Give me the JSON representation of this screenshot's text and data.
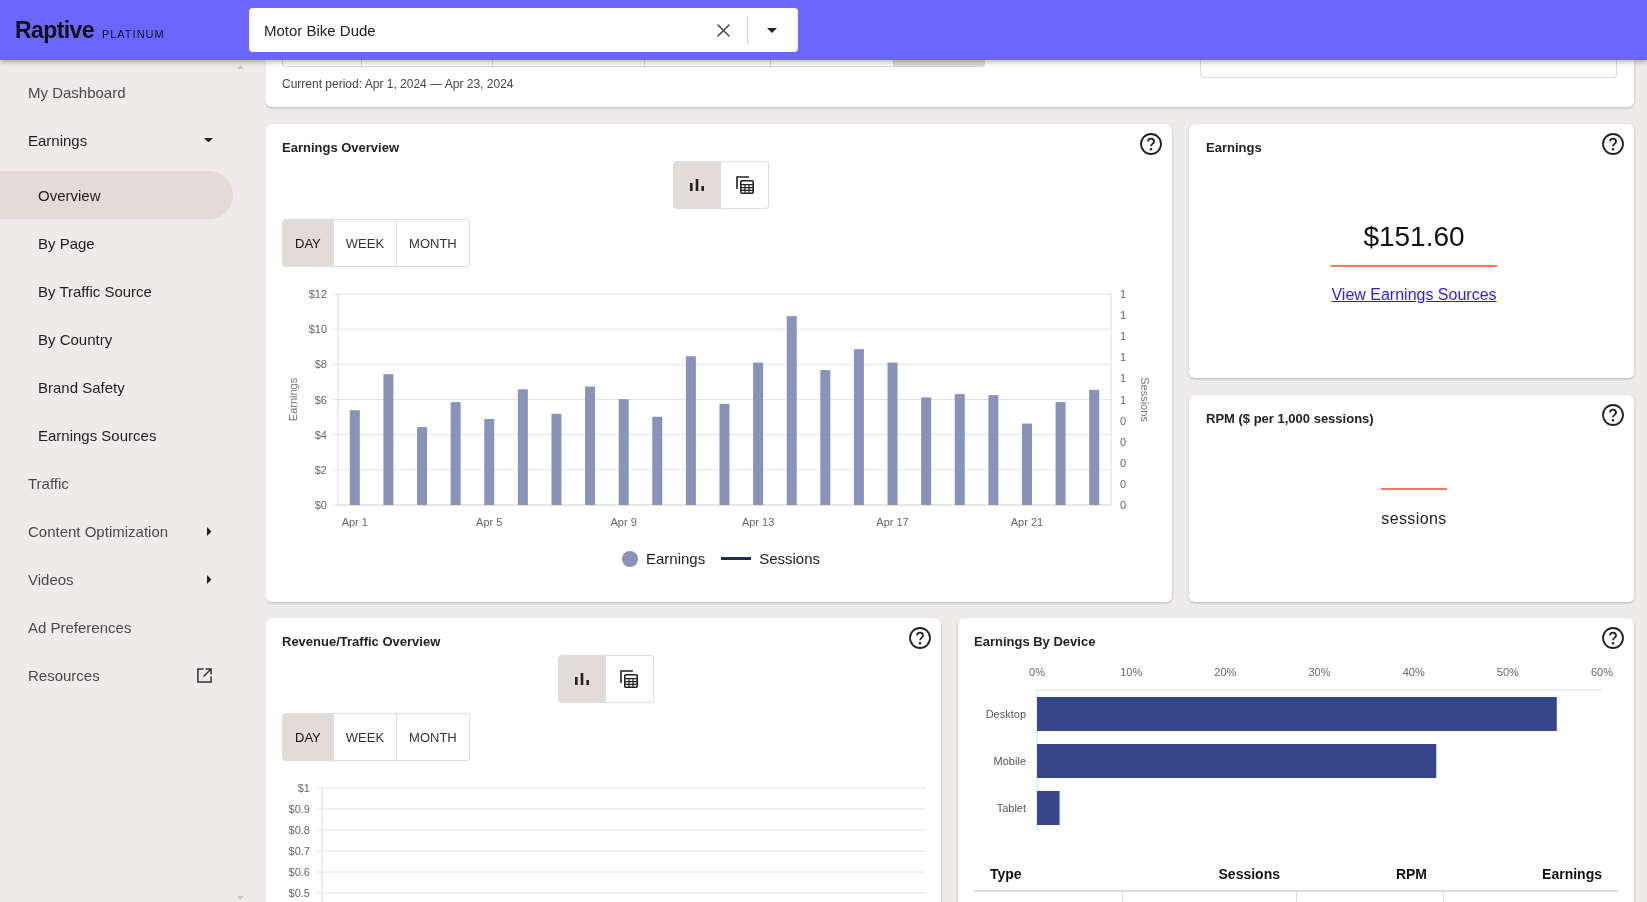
{
  "header": {
    "logo": "Raptive",
    "tier": "PLATINUM",
    "site_select": {
      "value": "Motor Bike Dude"
    }
  },
  "sidebar": {
    "items": [
      {
        "label": "My Dashboard",
        "kind": "link",
        "selected": false
      },
      {
        "label": "Earnings",
        "kind": "group",
        "expanded": true,
        "selected": false,
        "children": [
          {
            "label": "Overview",
            "selected": true
          },
          {
            "label": "By Page",
            "selected": false
          },
          {
            "label": "By Traffic Source",
            "selected": false
          },
          {
            "label": "By Country",
            "selected": false
          },
          {
            "label": "Brand Safety",
            "selected": false
          },
          {
            "label": "Earnings Sources",
            "selected": false
          }
        ]
      },
      {
        "label": "Traffic",
        "kind": "link",
        "selected": false
      },
      {
        "label": "Content Optimization",
        "kind": "group",
        "expanded": false,
        "selected": false
      },
      {
        "label": "Videos",
        "kind": "group",
        "expanded": false,
        "selected": false
      },
      {
        "label": "Ad Preferences",
        "kind": "link",
        "selected": false
      },
      {
        "label": "Resources",
        "kind": "external",
        "selected": false
      }
    ]
  },
  "period_bar": {
    "options": [
      {
        "selected": false
      },
      {
        "selected": false
      },
      {
        "selected": false
      },
      {
        "selected": false
      },
      {
        "selected": false
      },
      {
        "selected": true
      }
    ],
    "current_period": "Current period: Apr 1, 2024 — Apr 23, 2024"
  },
  "earnings_overview": {
    "title": "Earnings Overview",
    "view_toggle": [
      {
        "kind": "chart",
        "selected": true
      },
      {
        "kind": "table",
        "selected": false
      }
    ],
    "ranges": [
      {
        "label": "DAY",
        "selected": true
      },
      {
        "label": "WEEK",
        "selected": false
      },
      {
        "label": "MONTH",
        "selected": false
      }
    ],
    "chart_data": {
      "type": "bar",
      "grid": true,
      "ylabel": "Earnings",
      "categories": [
        "Apr 1",
        null,
        null,
        null,
        "Apr 5",
        null,
        null,
        null,
        "Apr 9",
        null,
        null,
        null,
        "Apr 13",
        null,
        null,
        null,
        "Apr 17",
        null,
        null,
        null,
        "Apr 21",
        null,
        null
      ],
      "ylim": [
        0,
        12
      ],
      "yticks": [
        {
          "value": 0,
          "label": "$0"
        },
        {
          "value": 2,
          "label": "$2"
        },
        {
          "value": 4,
          "label": "$4"
        },
        {
          "value": 6,
          "label": "$6"
        },
        {
          "value": 8,
          "label": "$8"
        },
        {
          "value": 10,
          "label": "$10"
        },
        {
          "value": 12,
          "label": "$12"
        }
      ],
      "series": [
        {
          "color": "#8893b9",
          "values": [
            5.39,
            7.44,
            4.43,
            5.85,
            4.89,
            6.58,
            5.19,
            6.74,
            6.02,
            5.02,
            8.46,
            5.75,
            8.1,
            10.74,
            7.67,
            8.86,
            8.1,
            6.12,
            6.31,
            6.25,
            4.63,
            5.85,
            6.55
          ]
        }
      ]
    },
    "secondary_axis": {
      "label": "Sessions",
      "ticks": [
        "1",
        "1",
        "1",
        "1",
        "1",
        "1",
        "0",
        "0",
        "0",
        "0",
        "0"
      ]
    },
    "legend": [
      {
        "label": "Earnings",
        "kind": "dot",
        "color": "#8893b9"
      },
      {
        "label": "Sessions",
        "kind": "line",
        "color": "#1f2b5b"
      }
    ]
  },
  "earnings_card": {
    "title": "Earnings",
    "value": "$151.60",
    "link": "View Earnings Sources"
  },
  "rpm_card": {
    "title": "RPM ($ per 1,000 sessions)",
    "caption": "sessions"
  },
  "revenue_traffic": {
    "title": "Revenue/Traffic Overview",
    "view_toggle": [
      {
        "kind": "chart",
        "selected": true
      },
      {
        "kind": "table",
        "selected": false
      }
    ],
    "ranges": [
      {
        "label": "DAY",
        "selected": true
      },
      {
        "label": "WEEK",
        "selected": false
      },
      {
        "label": "MONTH",
        "selected": false
      }
    ],
    "y_ticks": [
      "$1",
      "$0.9",
      "$0.8",
      "$0.7",
      "$0.6",
      "$0.5"
    ]
  },
  "earnings_by_device": {
    "title": "Earnings By Device",
    "chart_data": {
      "type": "bar",
      "orientation": "horizontal",
      "categories": [
        "Desktop",
        "Mobile",
        "Tablet"
      ],
      "series": [
        {
          "color": "#36468a",
          "values": [
            55.2,
            42.4,
            2.4
          ]
        }
      ],
      "xlim": [
        0,
        60
      ],
      "xticks": [
        {
          "value": 0,
          "label": "0%"
        },
        {
          "value": 10,
          "label": "10%"
        },
        {
          "value": 20,
          "label": "20%"
        },
        {
          "value": 30,
          "label": "30%"
        },
        {
          "value": 40,
          "label": "40%"
        },
        {
          "value": 50,
          "label": "50%"
        },
        {
          "value": 60,
          "label": "60%"
        }
      ]
    },
    "table": {
      "columns": [
        "Type",
        "Sessions",
        "RPM",
        "Earnings"
      ]
    }
  }
}
